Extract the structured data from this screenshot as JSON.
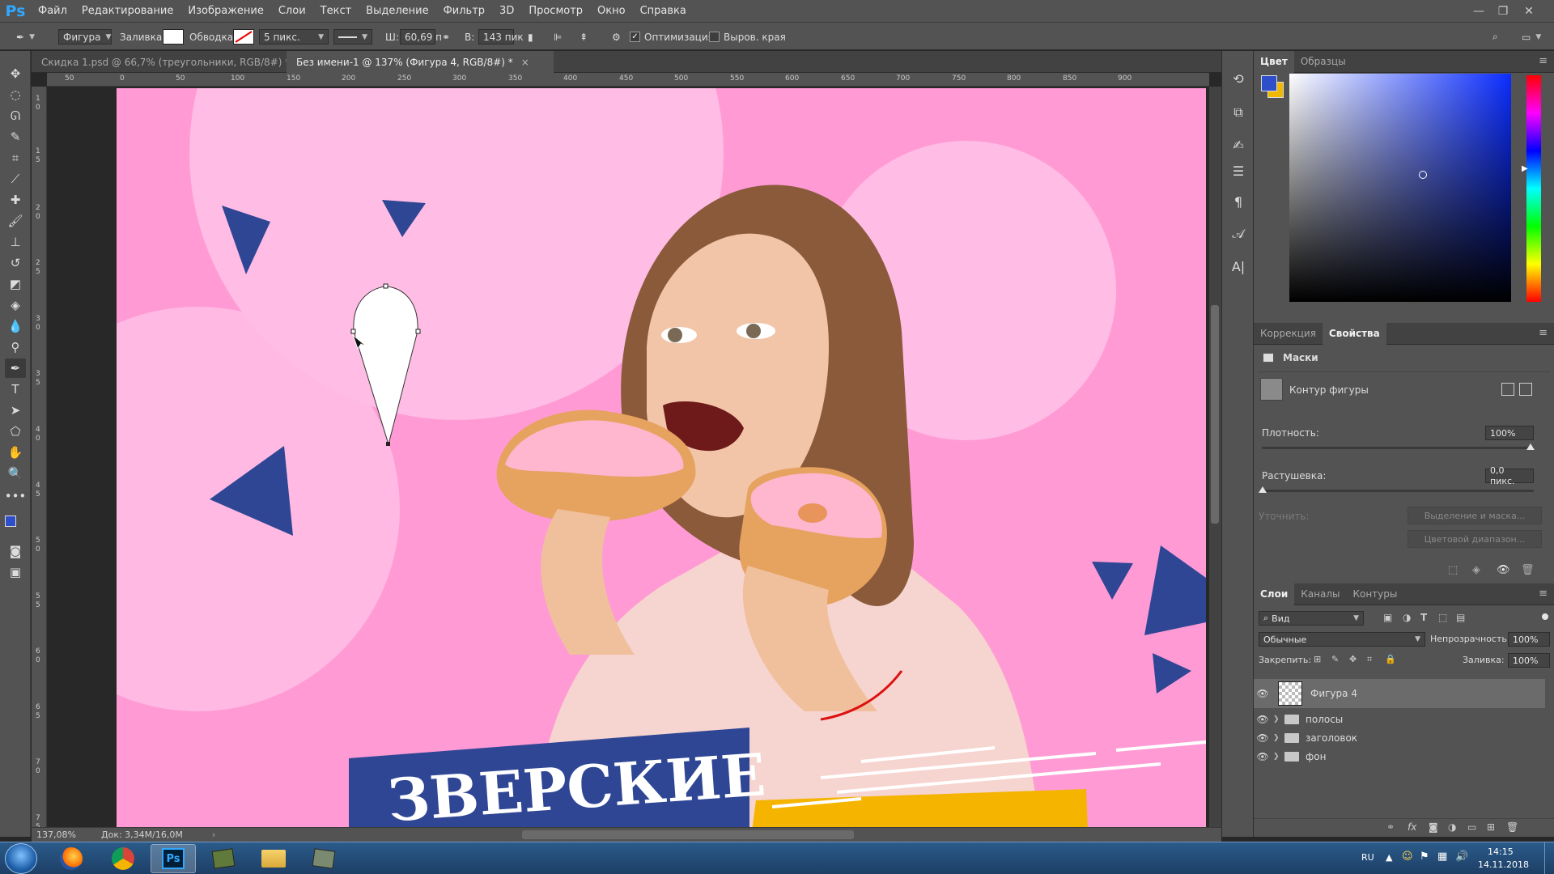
{
  "app": {
    "logo": "Ps"
  },
  "menu": [
    "Файл",
    "Редактирование",
    "Изображение",
    "Слои",
    "Текст",
    "Выделение",
    "Фильтр",
    "3D",
    "Просмотр",
    "Окно",
    "Справка"
  ],
  "options": {
    "mode": "Фигура",
    "fill_label": "Заливка:",
    "stroke_label": "Обводка:",
    "stroke_width": "5 пикс.",
    "w_label": "Ш:",
    "w_value": "60,69 п",
    "h_label": "В:",
    "h_value": "143 пик",
    "optimize_label": "Оптимизация",
    "align_edges_label": "Выров. края"
  },
  "tabs": [
    {
      "label": "Скидка 1.psd @ 66,7% (треугольники, RGB/8#) *",
      "active": false
    },
    {
      "label": "Без имени-1 @ 137% (Фигура 4, RGB/8#) *",
      "active": true
    }
  ],
  "ruler_top": [
    "50",
    "0",
    "50",
    "100",
    "150",
    "200",
    "250",
    "300",
    "350",
    "400",
    "450",
    "500",
    "550",
    "600",
    "650",
    "700",
    "750",
    "800",
    "850",
    "900"
  ],
  "ruler_left": [
    "1",
    "0",
    "1",
    "5",
    "2",
    "0",
    "2",
    "5",
    "3",
    "0",
    "3",
    "5",
    "4",
    "0",
    "4",
    "5",
    "5",
    "0",
    "5",
    "5",
    "6",
    "0",
    "6",
    "5",
    "7",
    "0",
    "7",
    "5"
  ],
  "canvas": {
    "banner_text": "ЗВЕРСКИЕ",
    "colors": {
      "background": "#ff9ad5",
      "circle": "#ffbce4",
      "triangle": "#2f4694",
      "banner": "#2f4694",
      "yellow": "#f4b400",
      "shape": "#ffffff"
    }
  },
  "status": {
    "zoom": "137,08%",
    "doc": "Док: 3,34M/16,0M"
  },
  "color_panel": {
    "tabs": [
      "Цвет",
      "Образцы"
    ],
    "fg_color": "#2f4ec9",
    "bg_color": "#f0b800",
    "field_hue": "#0b2dff"
  },
  "properties_panel": {
    "tabs": [
      "Коррекция",
      "Свойства"
    ],
    "section": "Маски",
    "mask_label": "Контур фигуры",
    "density_label": "Плотность:",
    "density_value": "100%",
    "feather_label": "Растушевка:",
    "feather_value": "0,0 пикс.",
    "refine_label": "Уточнить:",
    "btn_select_mask": "Выделение и маска...",
    "btn_color_range": "Цветовой диапазон..."
  },
  "layers_panel": {
    "tabs": [
      "Слои",
      "Каналы",
      "Контуры"
    ],
    "filter_kind": "Вид",
    "blend_mode": "Обычные",
    "opacity_label": "Непрозрачность:",
    "opacity_value": "100%",
    "lock_label": "Закрепить:",
    "fill_label": "Заливка:",
    "fill_value": "100%",
    "layers": [
      {
        "name": "Фигура 4",
        "type": "shape",
        "selected": true
      },
      {
        "name": "полосы",
        "type": "group"
      },
      {
        "name": "заголовок",
        "type": "group"
      },
      {
        "name": "фон",
        "type": "group"
      }
    ]
  },
  "taskbar": {
    "lang": "RU",
    "time": "14:15",
    "date": "14.11.2018"
  }
}
